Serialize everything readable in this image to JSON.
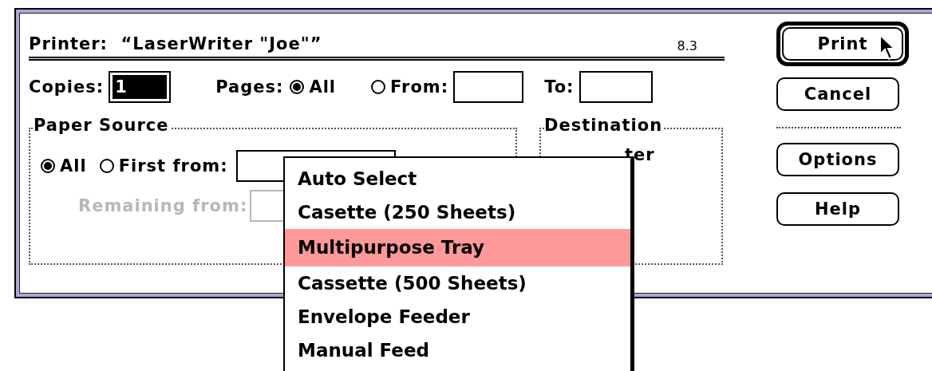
{
  "dialog": {
    "printer_label": "Printer:",
    "printer_name": "“LaserWriter \"Joe\"”",
    "version": "8.3",
    "copies": {
      "label": "Copies:",
      "value": "1",
      "selected": true
    },
    "pages": {
      "label": "Pages:",
      "options": [
        {
          "label": "All",
          "selected": true
        },
        {
          "label": "From:",
          "selected": false
        }
      ],
      "to_label": "To:"
    },
    "paper_source": {
      "title": "Paper Source",
      "options": [
        {
          "label": "All",
          "selected": true
        },
        {
          "label": "First from:",
          "selected": false
        }
      ],
      "remaining_label": "Remaining from:",
      "remaining_disabled": true
    },
    "destination": {
      "title": "Destination",
      "option_text": "ter"
    },
    "primary_buttons": [
      {
        "label": "Print",
        "default": true
      },
      {
        "label": "Cancel",
        "default": false
      }
    ],
    "secondary_buttons": [
      {
        "label": "Options"
      },
      {
        "label": "Help"
      }
    ]
  },
  "menu": {
    "items": [
      {
        "label": "Auto Select",
        "selected": false
      },
      {
        "label": "Casette (250 Sheets)",
        "selected": false
      },
      {
        "label": "Multipurpose Tray",
        "selected": true
      },
      {
        "label": "Cassette (500 Sheets)",
        "selected": false
      },
      {
        "label": "Envelope Feeder",
        "selected": false
      },
      {
        "label": "Manual Feed",
        "selected": false
      }
    ]
  }
}
